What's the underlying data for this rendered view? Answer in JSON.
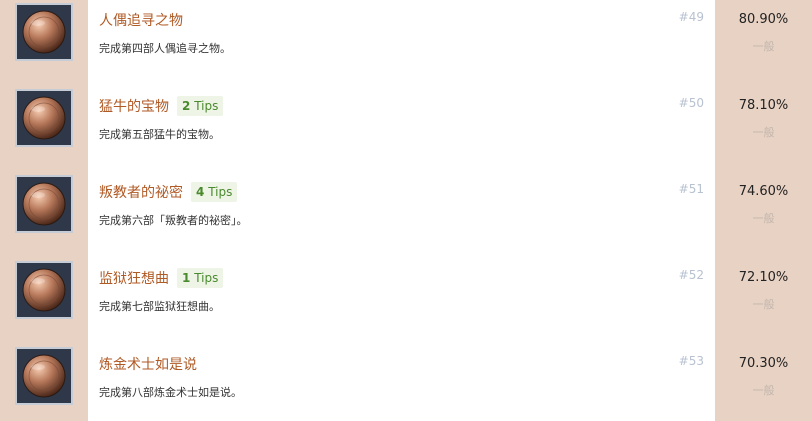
{
  "achievements": [
    {
      "title": "人偶追寻之物",
      "tips_count": "",
      "tips_label": "",
      "description": "完成第四部人偶追寻之物。",
      "number": "#49",
      "percent": "80.90%",
      "rarity": "一般",
      "icon": "bronze-medal-icon"
    },
    {
      "title": "猛牛的宝物",
      "tips_count": "2",
      "tips_label": "Tips",
      "description": "完成第五部猛牛的宝物。",
      "number": "#50",
      "percent": "78.10%",
      "rarity": "一般",
      "icon": "bronze-medal-icon"
    },
    {
      "title": "叛教者的祕密",
      "tips_count": "4",
      "tips_label": "Tips",
      "description": "完成第六部「叛教者的祕密」。",
      "number": "#51",
      "percent": "74.60%",
      "rarity": "一般",
      "icon": "bronze-medal-icon"
    },
    {
      "title": "监狱狂想曲",
      "tips_count": "1",
      "tips_label": "Tips",
      "description": "完成第七部监狱狂想曲。",
      "number": "#52",
      "percent": "72.10%",
      "rarity": "一般",
      "icon": "bronze-medal-icon"
    },
    {
      "title": "炼金术士如是说",
      "tips_count": "",
      "tips_label": "",
      "description": "完成第八部炼金术士如是说。",
      "number": "#53",
      "percent": "70.30%",
      "rarity": "一般",
      "icon": "bronze-medal-icon"
    }
  ],
  "colors": {
    "side_panel": "#e8d2c4",
    "title": "#b05a25",
    "tips_bg": "#eef4e6",
    "tips_text": "#4a8a2e",
    "number": "#b8c2d0",
    "rarity": "#c3b6ad"
  }
}
